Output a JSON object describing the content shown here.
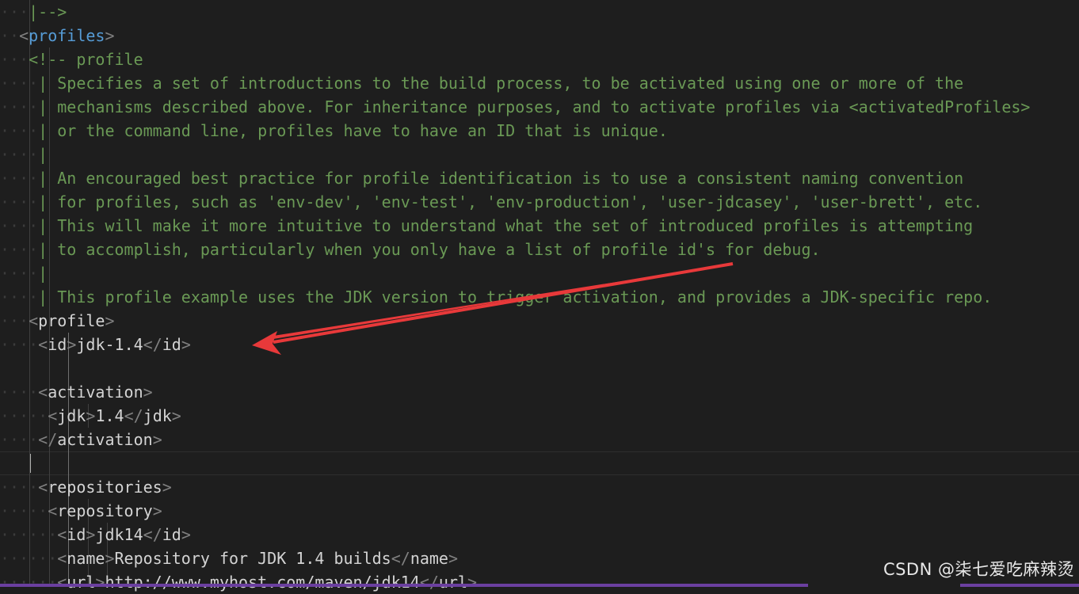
{
  "editor": {
    "lines": [
      "|-->",
      "<profiles>",
      "<!-- profile",
      "| Specifies a set of introductions to the build process, to be activated using one or more of the",
      "| mechanisms described above. For inheritance purposes, and to activate profiles via <activatedProfiles>",
      "| or the command line, profiles have to have an ID that is unique.",
      "|",
      "| An encouraged best practice for profile identification is to use a consistent naming convention",
      "| for profiles, such as 'env-dev', 'env-test', 'env-production', 'user-jdcasey', 'user-brett', etc.",
      "| This will make it more intuitive to understand what the set of introduced profiles is attempting",
      "| to accomplish, particularly when you only have a list of profile id's for debug.",
      "|",
      "| This profile example uses the JDK version to trigger activation, and provides a JDK-specific repo.",
      "<profile>",
      "<id>jdk-1.4</id>",
      "",
      "<activation>",
      "<jdk>1.4</jdk>",
      "</activation>",
      "",
      "<repositories>",
      "<repository>",
      "<id>jdk14</id>",
      "<name>Repository for JDK 1.4 builds</name>",
      "<url>http://www.myhost.com/maven/jdk14</url>"
    ]
  },
  "watermark": "CSDN @柒七爱吃麻辣烫",
  "colors": {
    "background": "#1e1e1e",
    "comment": "#6a9955",
    "tag_bracket": "#808080",
    "tag_name_profiles": "#569cd6",
    "tag_name": "#d4d4d4",
    "annotation_arrow": "#e8393a",
    "scrollbar": "#6b3fa0"
  },
  "annotation": {
    "type": "arrow",
    "points_to": "<id>jdk-1.4</id>"
  }
}
